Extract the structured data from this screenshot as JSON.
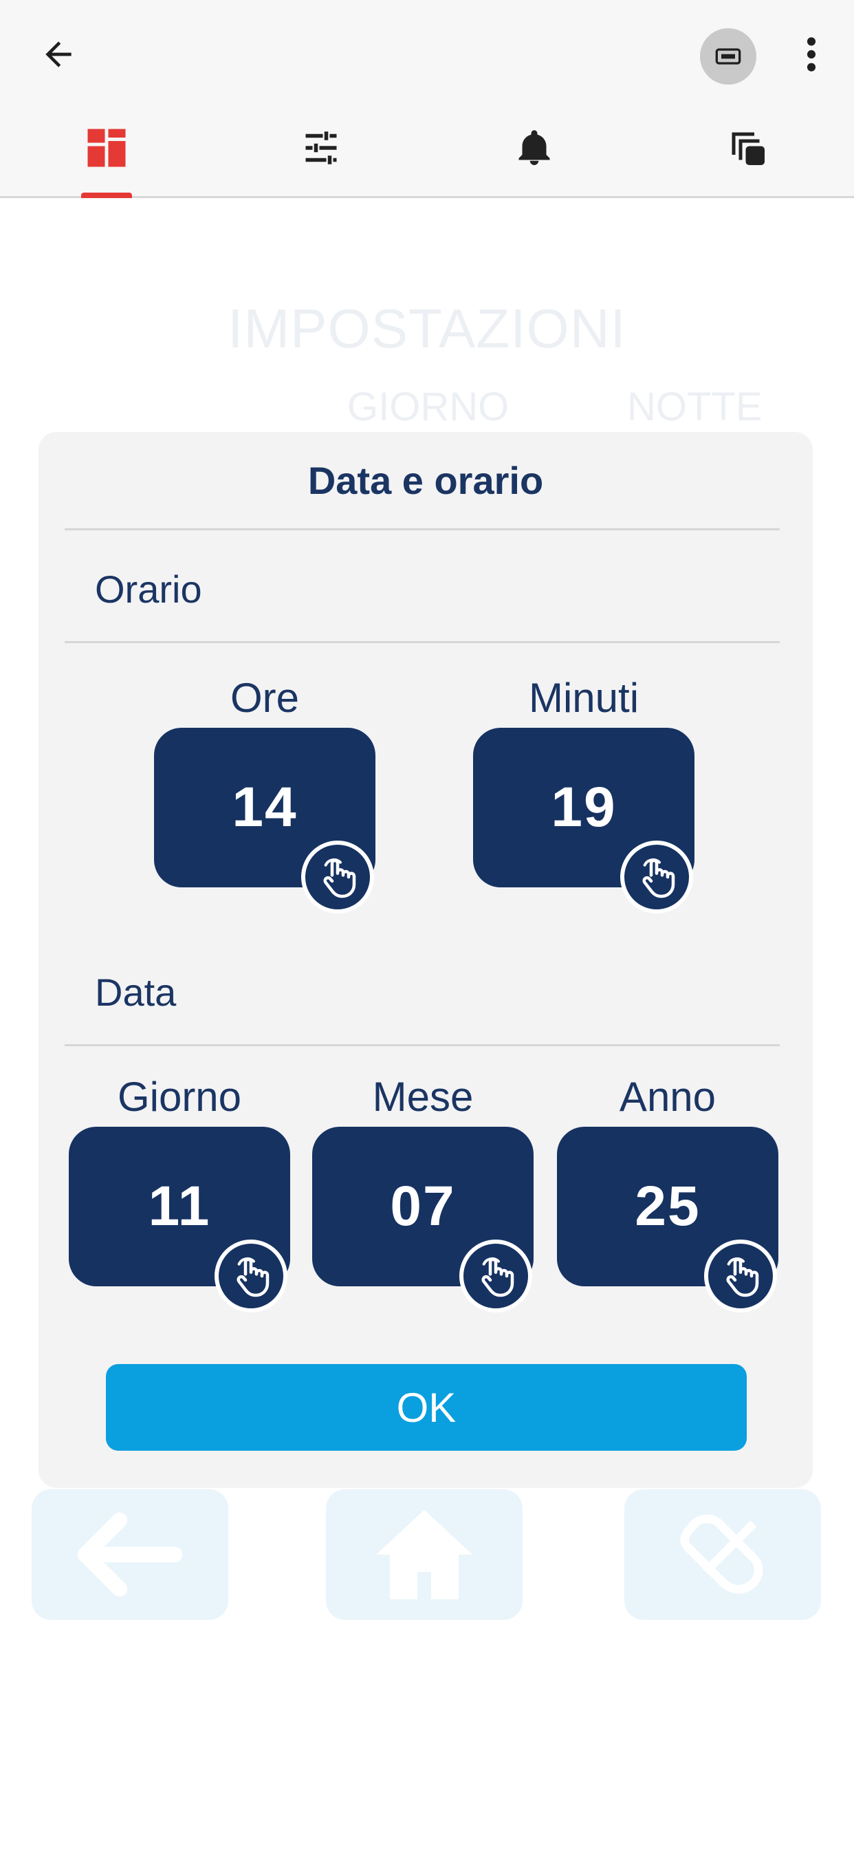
{
  "app_bar": {
    "back_icon": "arrow-back-icon",
    "cast_icon": "screen-cast-icon",
    "more_icon": "more-vertical-icon",
    "tabs": [
      {
        "icon": "dashboard-icon",
        "selected": true,
        "color": "#e53935"
      },
      {
        "icon": "sliders-icon",
        "selected": false,
        "color": "#222222"
      },
      {
        "icon": "bell-icon",
        "selected": false,
        "color": "#222222"
      },
      {
        "icon": "copy-icon",
        "selected": false,
        "color": "#222222"
      }
    ]
  },
  "background_page": {
    "title": "IMPOSTAZIONI",
    "subtabs": [
      "GIORNO",
      "NOTTE"
    ],
    "bottom_buttons": [
      "arrow-left-icon",
      "home-icon",
      "tools-icon"
    ]
  },
  "dialog": {
    "title": "Data e orario",
    "time_section": {
      "label": "Orario",
      "fields": [
        {
          "label": "Ore",
          "value": "14"
        },
        {
          "label": "Minuti",
          "value": "19"
        }
      ]
    },
    "date_section": {
      "label": "Data",
      "fields": [
        {
          "label": "Giorno",
          "value": "11"
        },
        {
          "label": "Mese",
          "value": "07"
        },
        {
          "label": "Anno",
          "value": "25"
        }
      ]
    },
    "ok_label": "OK"
  },
  "colors": {
    "accent_red": "#e53935",
    "navy": "#163261",
    "text_navy": "#1b3563",
    "ok_blue": "#0a9fdf"
  }
}
